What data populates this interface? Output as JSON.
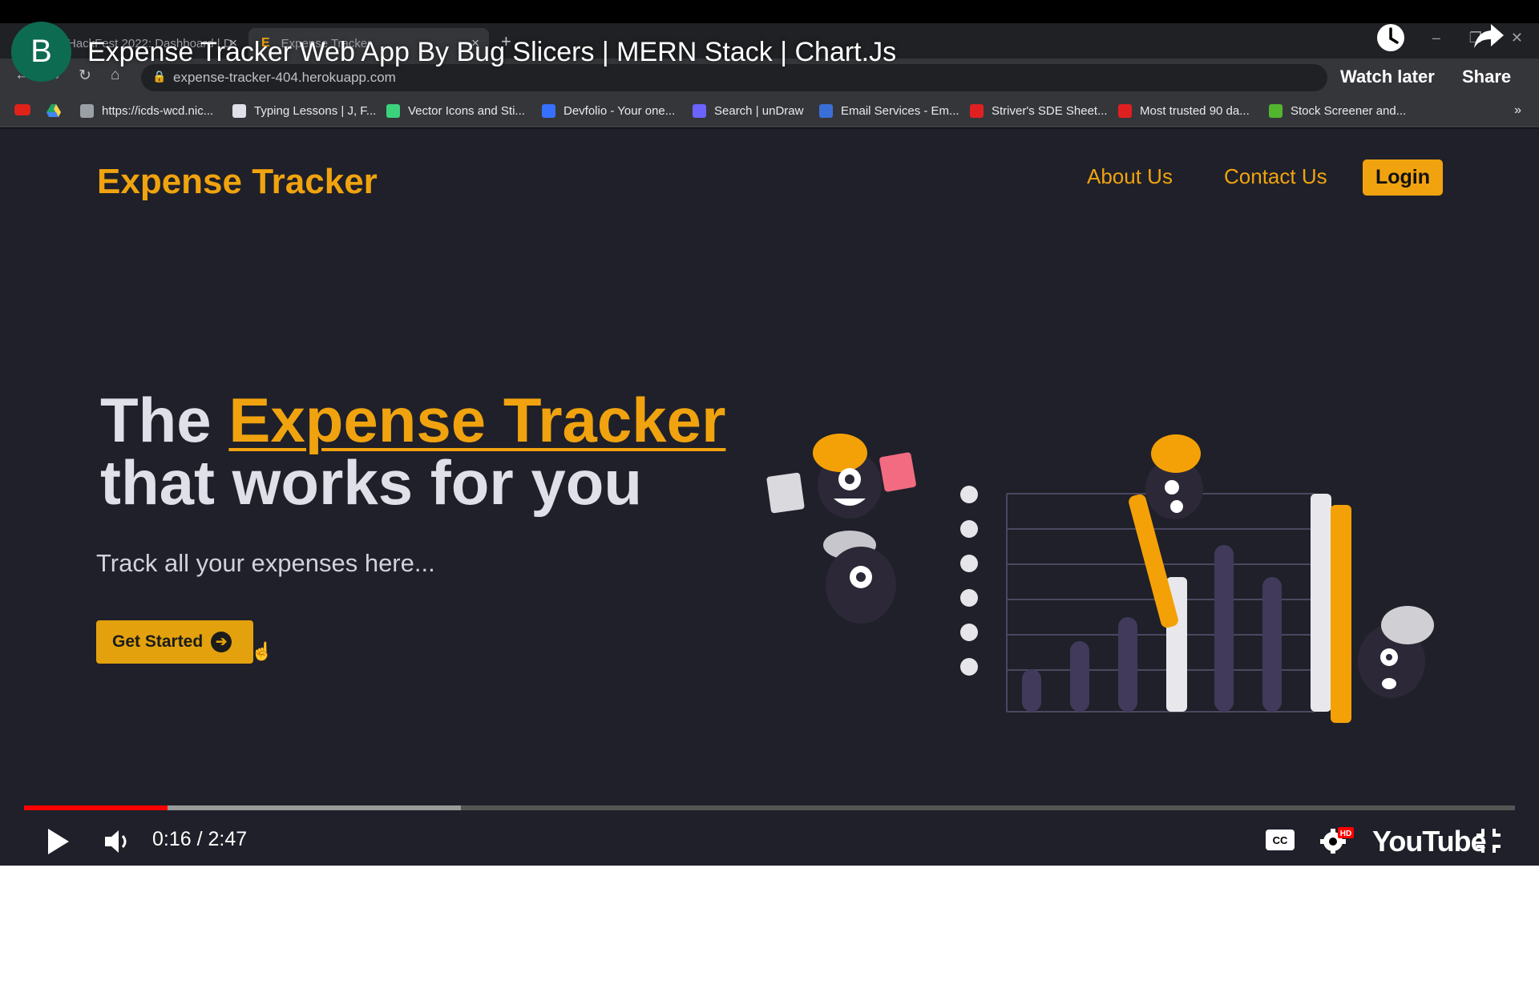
{
  "browser": {
    "tabs": [
      {
        "label": "HackFest 2022: Dashboard | D"
      },
      {
        "favicon": "E",
        "label": "Expense Tracker"
      }
    ],
    "url": "expense-tracker-404.herokuapp.com",
    "bookmarks": [
      {
        "label": "https://icds-wcd.nic...",
        "icon": "globe-icon",
        "color": "#9aa0a6"
      },
      {
        "label": "Typing Lessons | J, F...",
        "icon": "typing-icon",
        "color": "#dfe0e8"
      },
      {
        "label": "Vector Icons and Sti...",
        "icon": "vector-icon",
        "color": "#3bd27c"
      },
      {
        "label": "Devfolio - Your one...",
        "icon": "devfolio-icon",
        "color": "#3770ff"
      },
      {
        "label": "Search | unDraw",
        "icon": "undraw-icon",
        "color": "#6c63ff"
      },
      {
        "label": "Email Services - Em...",
        "icon": "email-icon",
        "color": "#3a6fd8"
      },
      {
        "label": "Striver's SDE Sheet...",
        "icon": "tuf-icon",
        "color": "#e02020"
      },
      {
        "label": "Most trusted 90 da...",
        "icon": "tuf-icon",
        "color": "#e02020"
      },
      {
        "label": "Stock Screener and...",
        "icon": "chart-icon",
        "color": "#52b52e"
      }
    ]
  },
  "site": {
    "logo": "Expense Tracker",
    "nav": {
      "about": "About Us",
      "contact": "Contact Us",
      "login": "Login"
    },
    "hero": {
      "title_prefix": "The ",
      "title_accent": "Expense Tracker",
      "title_line2": "that works for you",
      "subtitle": "Track all your expenses here...",
      "cta": "Get Started"
    },
    "colors": {
      "accent": "#f0a30f",
      "background": "#1f2029",
      "text": "#dfe0e8"
    }
  },
  "video": {
    "channel_initial": "B",
    "title": "Expense Tracker Web App By Bug Slicers | MERN Stack | Chart.Js",
    "watch_later": "Watch later",
    "share": "Share",
    "current_time": "0:16",
    "duration": "2:47",
    "time_display": "0:16 / 2:47",
    "progress_fraction": 0.096,
    "buffered_fraction": 0.293,
    "brand": "YouTube",
    "quality_badge": "HD"
  }
}
